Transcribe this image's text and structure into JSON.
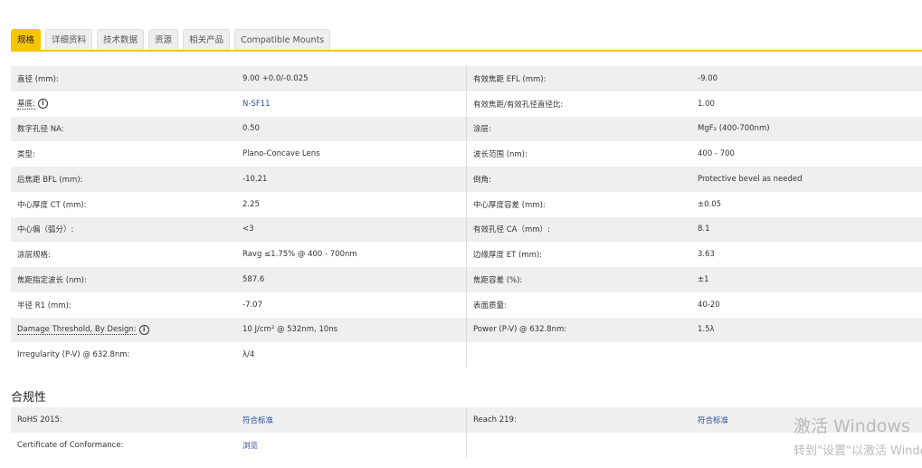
{
  "tabs": [
    "规格",
    "详细资料",
    "技术数据",
    "资源",
    "相关产品",
    "Compatible Mounts"
  ],
  "specs_left": [
    {
      "label": "直径 (mm):",
      "value": "9.00 +0.0/-0.025"
    },
    {
      "label": "基底:",
      "value": "N-SF11",
      "info": true,
      "link": true
    },
    {
      "label": "数字孔径 NA:",
      "value": "0.50"
    },
    {
      "label": "类型:",
      "value": "Plano-Concave Lens"
    },
    {
      "label": "后焦距 BFL (mm):",
      "value": "-10.21"
    },
    {
      "label": "中心厚度 CT (mm):",
      "value": "2.25"
    },
    {
      "label": "中心偏（弧分）:",
      "value": "<3"
    },
    {
      "label": "涂层规格:",
      "value": "Ravg ≤1.75% @ 400 - 700nm"
    },
    {
      "label": "焦距指定波长 (nm):",
      "value": "587.6"
    },
    {
      "label": "半径 R1 (mm):",
      "value": "-7.07"
    },
    {
      "label": "Damage Threshold, By Design:",
      "value": "10 J/cm² @ 532nm, 10ns",
      "info": true
    },
    {
      "label": "Irregularity (P-V) @ 632.8nm:",
      "value": "λ/4"
    }
  ],
  "specs_right": [
    {
      "label": "有效焦距 EFL (mm):",
      "value": "-9.00"
    },
    {
      "label": "有效焦距/有效孔径直径比:",
      "value": "1.00"
    },
    {
      "label": "涂层:",
      "value": "MgF₂ (400-700nm)"
    },
    {
      "label": "波长范围 (nm):",
      "value": "400 - 700"
    },
    {
      "label": "倒角:",
      "value": "Protective bevel as needed"
    },
    {
      "label": "中心厚度容差 (mm):",
      "value": "±0.05"
    },
    {
      "label": "有效孔径 CA（mm）:",
      "value": "8.1"
    },
    {
      "label": "边缘厚度 ET (mm):",
      "value": "3.63"
    },
    {
      "label": "焦距容差 (%):",
      "value": "±1"
    },
    {
      "label": "表面质量:",
      "value": "40-20"
    },
    {
      "label": "Power (P-V) @ 632.8nm:",
      "value": "1.5λ"
    },
    {
      "label": "",
      "value": ""
    }
  ],
  "compliance": {
    "title": "合规性",
    "rows": [
      {
        "l": "RoHS 2015:",
        "v": "符合标准",
        "rl": "Reach 219:",
        "rv": "符合标准"
      },
      {
        "l": "Certificate of Conformance:",
        "v": "浏览",
        "rl": "",
        "rv": ""
      }
    ]
  },
  "watermark": {
    "line1": "激活 Windows",
    "line2": "转到\"设置\"以激活 Windows。"
  }
}
